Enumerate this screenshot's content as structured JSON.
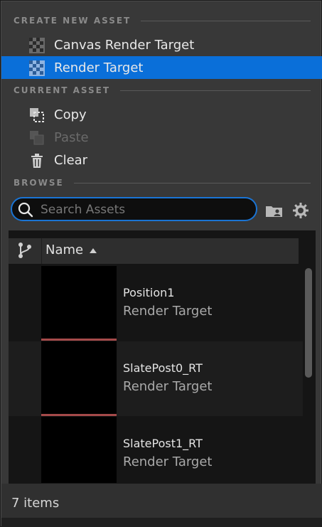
{
  "sections": {
    "create_new_asset": "CREATE NEW ASSET",
    "current_asset": "CURRENT ASSET",
    "browse": "BROWSE"
  },
  "create_items": [
    {
      "label": "Canvas Render Target",
      "icon": "render-target-checker-icon"
    },
    {
      "label": "Render Target",
      "icon": "render-target-checker-icon",
      "selected": true
    }
  ],
  "current_items": [
    {
      "label": "Copy",
      "icon": "copy-icon"
    },
    {
      "label": "Paste",
      "icon": "paste-icon",
      "disabled": true
    },
    {
      "label": "Clear",
      "icon": "trash-icon"
    }
  ],
  "search": {
    "placeholder": "Search Assets"
  },
  "list": {
    "column_name": "Name",
    "sort": "ascending",
    "rows": [
      {
        "name": "Position1",
        "type": "Render Target"
      },
      {
        "name": "SlatePost0_RT",
        "type": "Render Target"
      },
      {
        "name": "SlatePost1_RT",
        "type": "Render Target"
      }
    ]
  },
  "footer": {
    "count": "7 items"
  },
  "colors": {
    "selection": "#0a6fd9",
    "search_border": "#1a74d4",
    "thumb_underline": "#a54a4a"
  }
}
